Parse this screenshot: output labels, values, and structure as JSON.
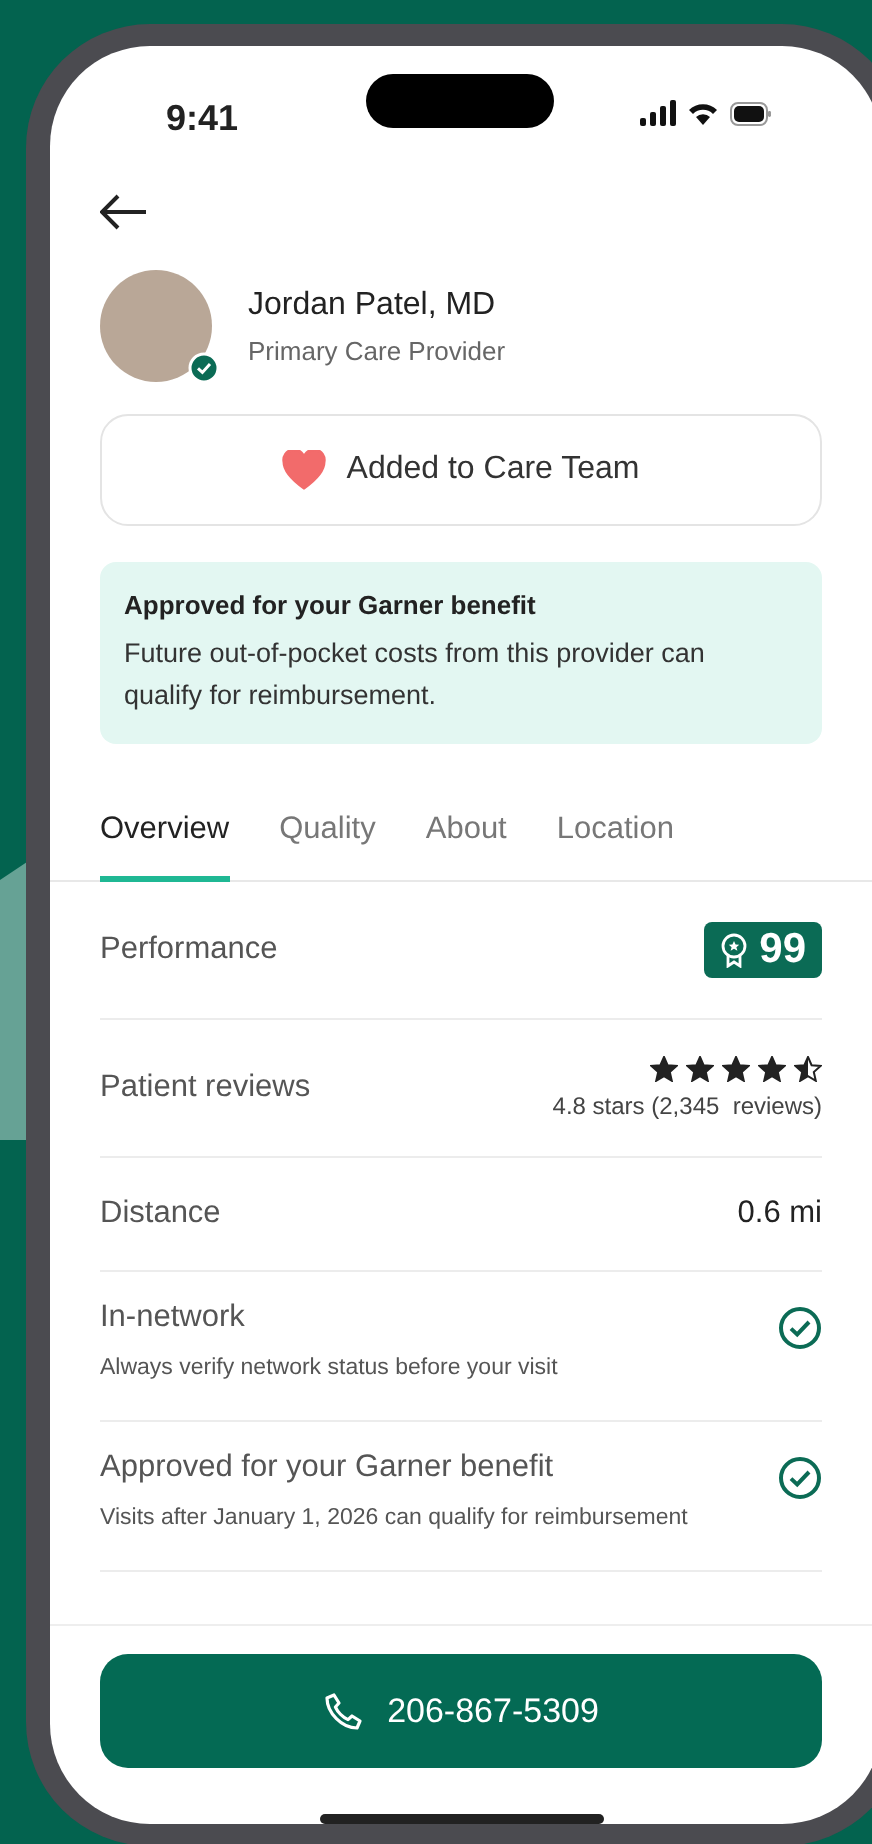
{
  "status_bar": {
    "time": "9:41"
  },
  "provider": {
    "name": "Jordan Patel, MD",
    "role": "Primary Care Provider",
    "verified": true
  },
  "care_team_button": {
    "label": "Added to Care Team",
    "added": true
  },
  "notice": {
    "title": "Approved for your Garner benefit",
    "text": "Future out-of-pocket costs from this provider can qualify for reimbursement."
  },
  "tabs": [
    {
      "label": "Overview",
      "selected": true
    },
    {
      "label": "Quality",
      "selected": false
    },
    {
      "label": "About",
      "selected": false
    },
    {
      "label": "Location",
      "selected": false
    }
  ],
  "rows": [
    {
      "kind": "badge",
      "label": "Performance",
      "value": "99"
    },
    {
      "kind": "stars",
      "label": "Patient reviews",
      "stars": 4.5,
      "caption": "4.8 stars (2,345  reviews)"
    },
    {
      "kind": "value",
      "label": "Distance",
      "value": "0.6 mi"
    },
    {
      "kind": "check",
      "label": "In-network",
      "note": "Always verify network status before your visit",
      "checked": true
    },
    {
      "kind": "check",
      "label": "Approved for your Garner benefit",
      "note": "Visits after January 1, 2026 can qualify for reimbursement",
      "checked": true
    }
  ],
  "call_button": {
    "label": "206-867-5309"
  }
}
